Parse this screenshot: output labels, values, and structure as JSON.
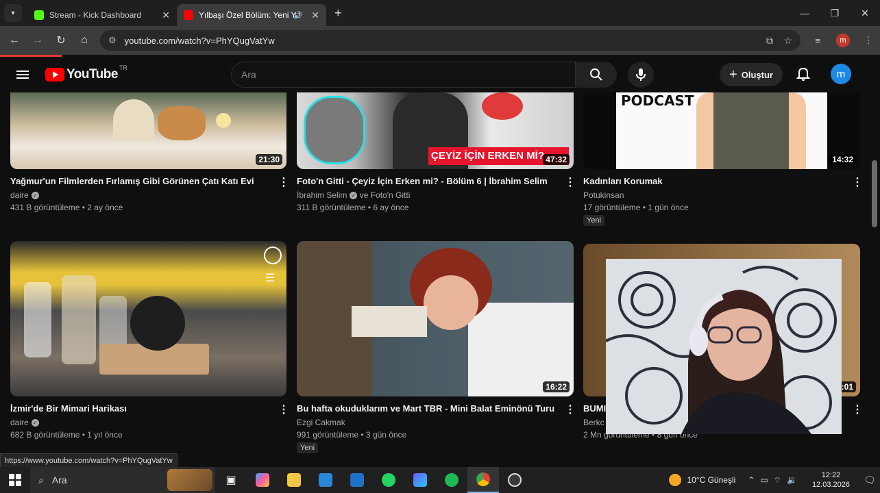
{
  "browser": {
    "tabs": [
      {
        "title": "Stream - Kick Dashboard",
        "active": false
      },
      {
        "title": "Yılbaşı Özel Bölüm: Yeni Yıl",
        "active": true
      }
    ],
    "url": "youtube.com/watch?v=PhYQugVatYw",
    "status_url": "https://www.youtube.com/watch?v=PhYQugVatYw",
    "profile_initial": "m"
  },
  "youtube": {
    "logo_text": "YouTube",
    "region": "TR",
    "search_placeholder": "Ara",
    "create_label": "Oluştur",
    "avatar_initial": "m"
  },
  "videos": [
    {
      "title": "Yağmur'un Filmlerden Fırlamış Gibi Görünen Çatı Katı Evi",
      "channel": "daire",
      "verified": true,
      "meta": "431 B görüntüleme • 2 ay önce",
      "duration": "21:30",
      "badge": ""
    },
    {
      "title": "Foto'n Gitti - Çeyiz İçin Erken mi? - Bölüm 6 | İbrahim Selim",
      "channel": "İbrahim Selim",
      "channel2": "ve Foto'n Gitti",
      "verified": true,
      "meta": "311 B görüntüleme • 6 ay önce",
      "duration": "47:32",
      "badge": "",
      "thumb_text": "ÇEYİZ İÇİN ERKEN Mİ?"
    },
    {
      "title": "Kadınları Korumak",
      "channel": "Potukinsan",
      "verified": false,
      "meta": "17 görüntüleme • 1 gün önce",
      "duration": "14:32",
      "badge": "Yeni",
      "thumb_text": "PODCAST"
    },
    {
      "title": "İzmir'de Bir Mimari Harikası",
      "channel": "daire",
      "verified": true,
      "meta": "682 B görüntüleme • 1 yıl önce",
      "duration": "",
      "badge": ""
    },
    {
      "title": "Bu hafta okuduklarım ve Mart TBR - Mini Balat Eminönü Turu",
      "channel": "Ezgi Cakmak",
      "verified": false,
      "meta": "991 görüntüleme • 3 gün önce",
      "duration": "16:22",
      "badge": "Yeni"
    },
    {
      "title": "BUMI",
      "channel": "Berkc",
      "verified": false,
      "meta": "2 Mn görüntüleme • 8 gün önce",
      "duration": "8:01",
      "badge": ""
    }
  ],
  "taskbar": {
    "search_label": "Ara",
    "weather": "10°C  Güneşli",
    "time": "12:22",
    "date": "12.03.2026"
  }
}
